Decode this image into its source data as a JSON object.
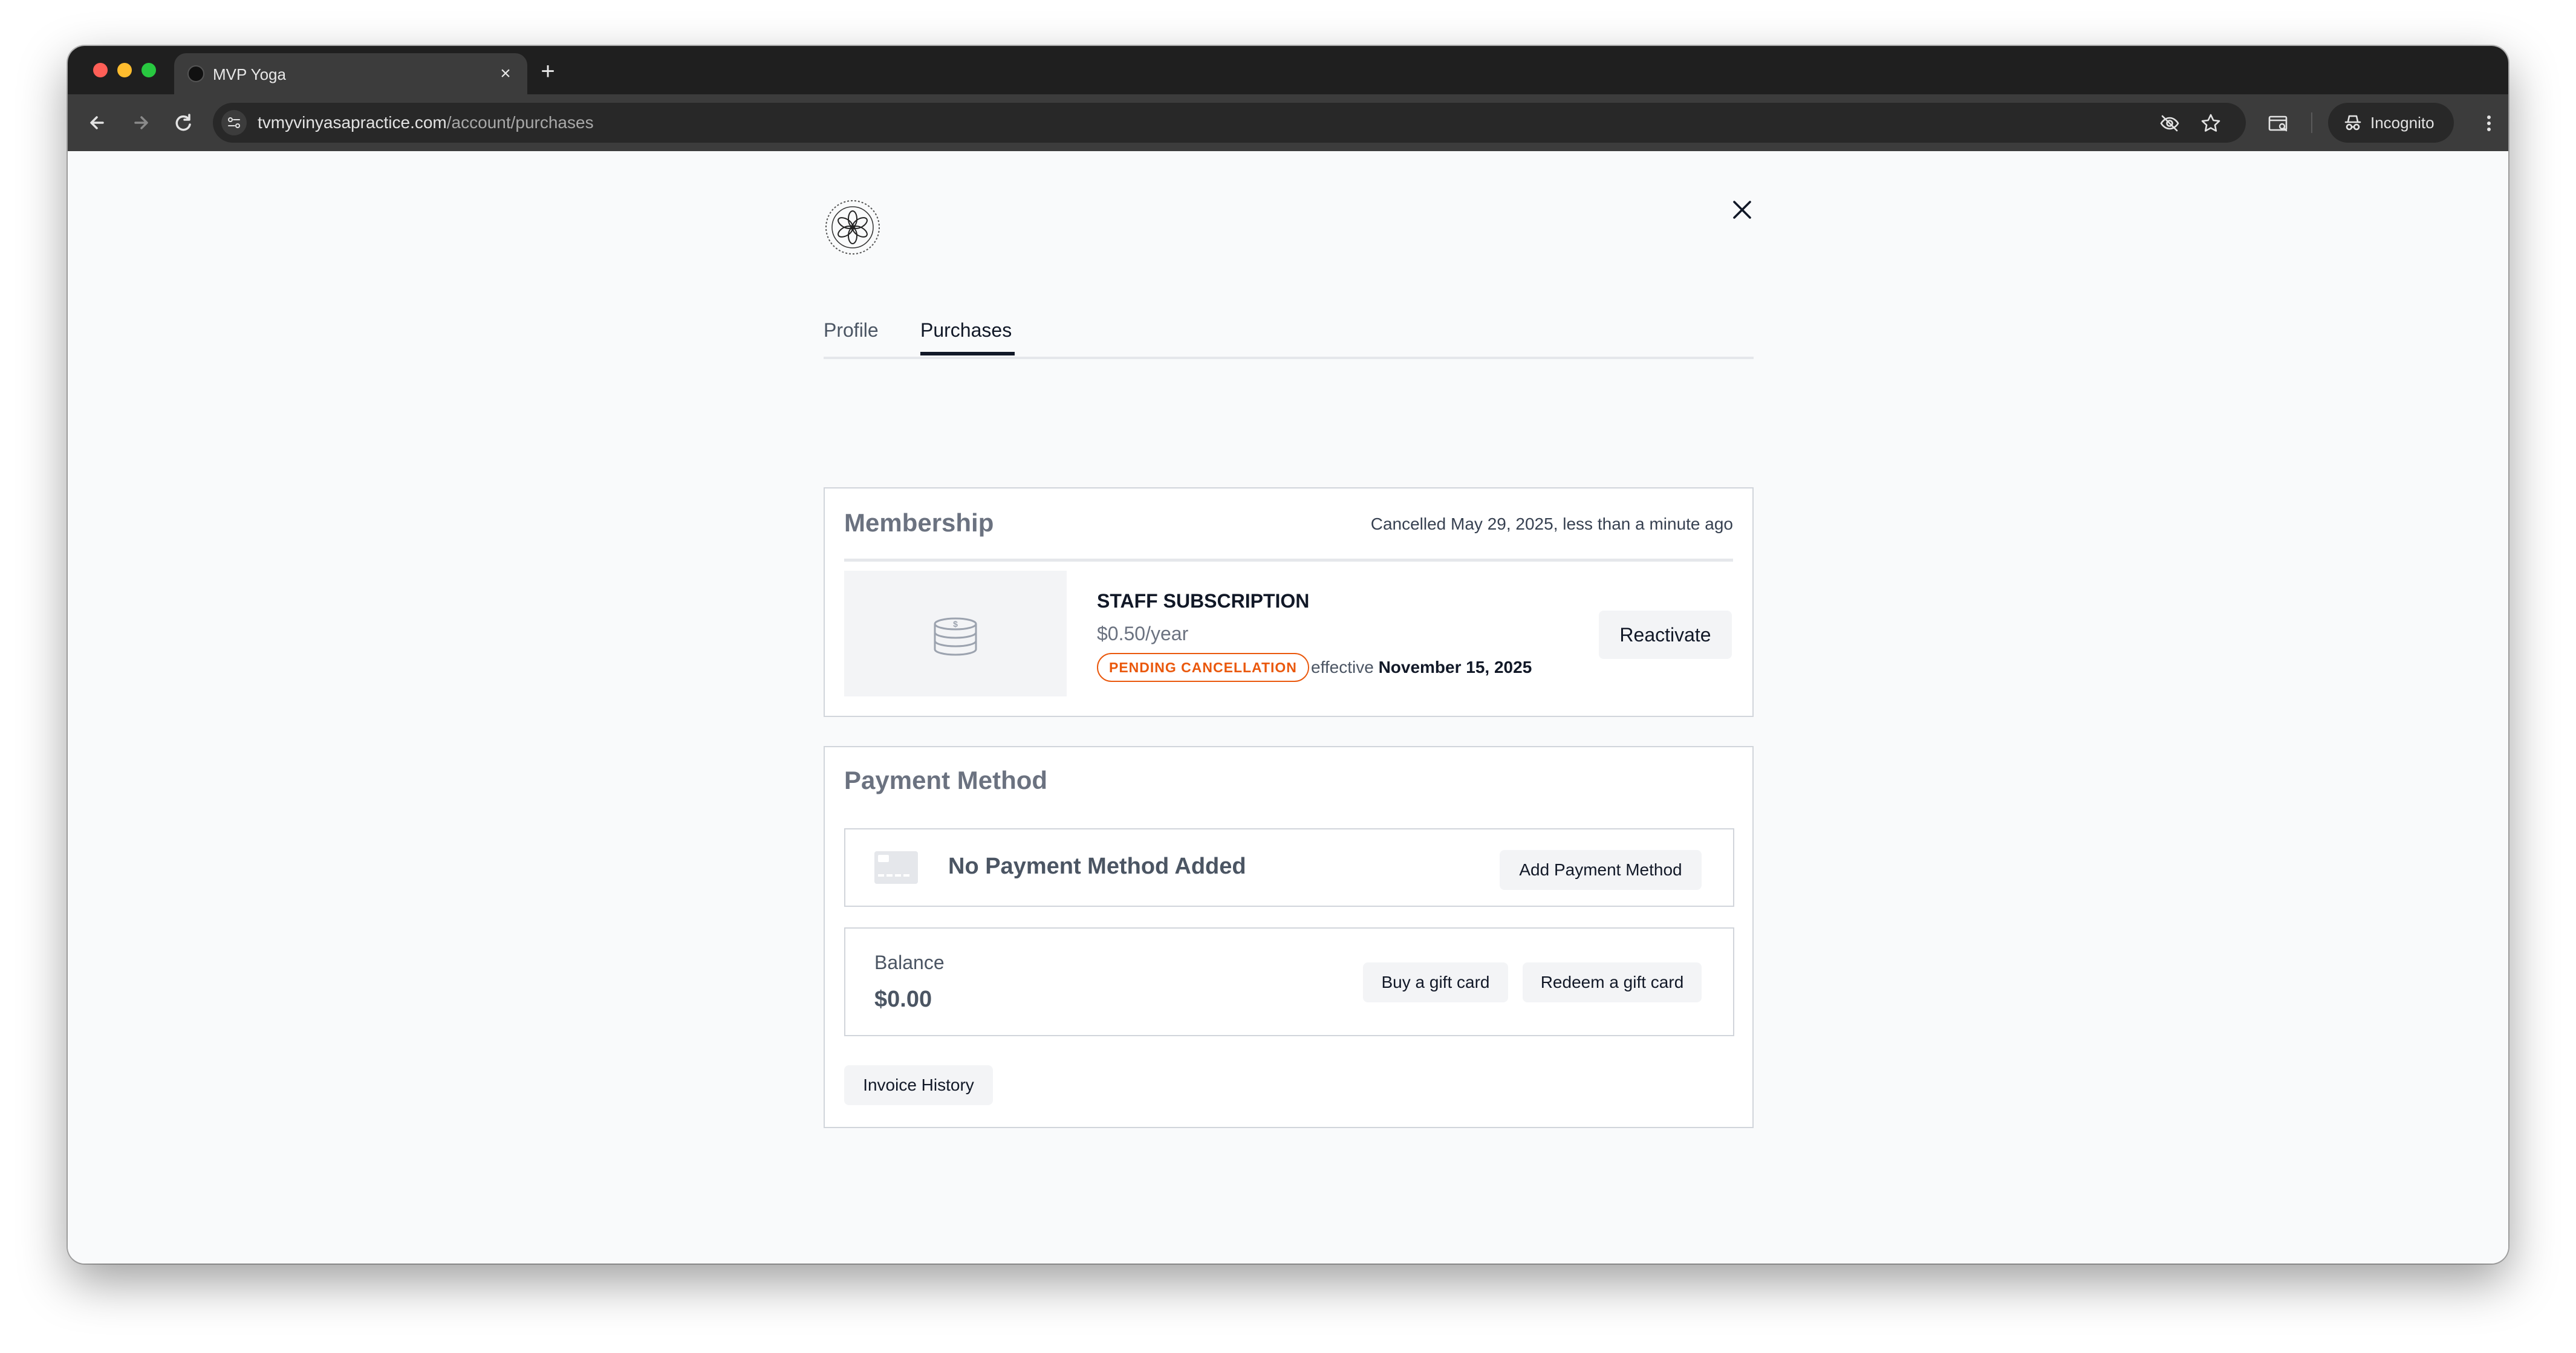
{
  "browser": {
    "tab_title": "MVP Yoga",
    "tab_close_glyph": "×",
    "new_tab_glyph": "+",
    "url_domain": "tvmyvinyasapractice.com",
    "url_path": "/account/purchases",
    "incognito_label": "Incognito",
    "icons": [
      "back-arrow-icon",
      "forward-arrow-icon",
      "reload-icon",
      "site-info-icon",
      "eye-off-icon",
      "star-icon",
      "reader-mode-icon",
      "incognito-icon",
      "more-menu-icon"
    ]
  },
  "page": {
    "tabs": [
      {
        "label": "Profile",
        "active": false
      },
      {
        "label": "Purchases",
        "active": true
      }
    ],
    "membership": {
      "heading": "Membership",
      "status": "Cancelled May 29, 2025, less than a minute ago",
      "plan_name": "STAFF SUBSCRIPTION",
      "plan_price": "$0.50/year",
      "badge": "PENDING CANCELLATION",
      "effective_prefix": "effective",
      "effective_date": "November 15, 2025",
      "reactivate_label": "Reactivate"
    },
    "payment": {
      "heading": "Payment Method",
      "no_method_text": "No Payment Method Added",
      "add_method_label": "Add Payment Method",
      "balance_label": "Balance",
      "balance_value": "$0.00",
      "buy_gift_label": "Buy a gift card",
      "redeem_gift_label": "Redeem a gift card",
      "invoice_label": "Invoice History"
    }
  },
  "colors": {
    "accent_orange": "#ea580c",
    "active_tab": "#111827",
    "heading_gray": "#6b7280"
  }
}
